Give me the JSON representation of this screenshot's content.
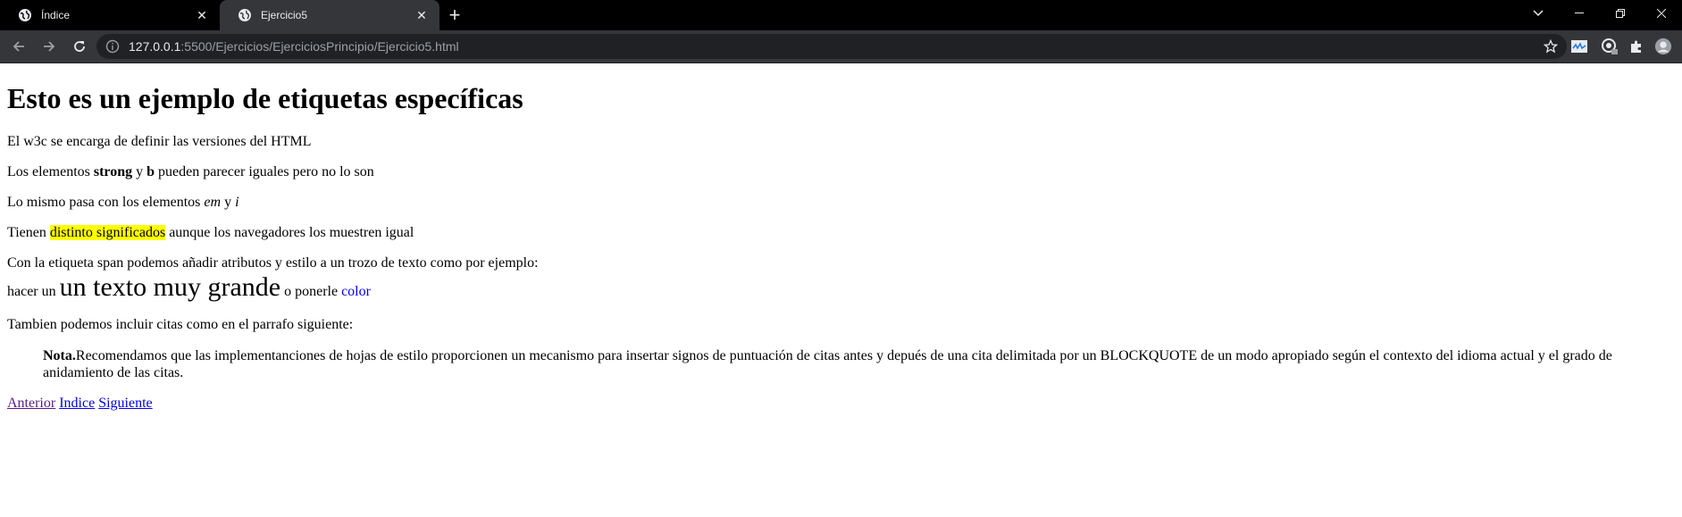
{
  "browser": {
    "tabs": [
      {
        "title": "Índice",
        "active": false
      },
      {
        "title": "Ejercicio5",
        "active": true
      }
    ],
    "url_host": "127.0.0.1",
    "url_path": ":5500/Ejercicios/EjerciciosPrincipio/Ejercicio5.html"
  },
  "page": {
    "heading": "Esto es un ejemplo de etiquetas específicas",
    "p1": "El w3c se encarga de definir las versiones del HTML",
    "p2": {
      "a": "Los elementos ",
      "strong": "strong",
      "b_mid": " y ",
      "b": "b",
      "rest": " pueden parecer iguales pero no lo son"
    },
    "p3": {
      "a": "Lo mismo pasa con los elementos ",
      "em": "em",
      "mid": " y ",
      "i": "i"
    },
    "p4": {
      "a": "Tienen ",
      "mark": "distinto significados",
      "rest": " aunque los navegadores los muestren igual"
    },
    "p5": "Con la etiqueta span podemos añadir atributos y estilo a un trozo de texto como por ejemplo:",
    "p6": {
      "a": "hacer un ",
      "big": "un texto muy grande",
      "mid": " o ponerle ",
      "color": "color"
    },
    "p7": "Tambien podemos incluir citas como en el parrafo siguiente:",
    "quote": {
      "bold": "Nota.",
      "text": "Recomendamos que las implementanciones de hojas de estilo proporcionen un mecanismo para insertar signos de puntuación de citas antes y depués de una cita delimitada por un BLOCKQUOTE de un modo apropiado según el contexto del idioma actual y el grado de anidamiento de las citas."
    },
    "links": {
      "prev": "Anterior",
      "index": "Indice",
      "next": "Siguiente"
    }
  },
  "colors": {
    "mark": "#ffff00",
    "blue_span": "#0000ff",
    "visited_link": "#551a8b",
    "link": "#0000ee"
  }
}
